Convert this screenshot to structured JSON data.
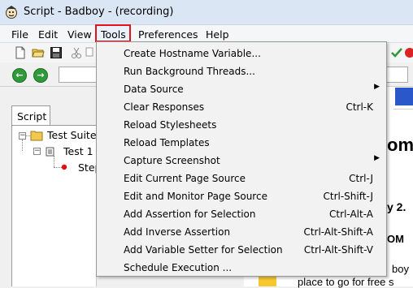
{
  "window": {
    "title": "Script - Badboy - (recording)"
  },
  "menubar": {
    "items": [
      {
        "label": "File"
      },
      {
        "label": "Edit"
      },
      {
        "label": "View"
      },
      {
        "label": "Tools"
      },
      {
        "label": "Preferences"
      },
      {
        "label": "Help"
      }
    ],
    "highlight_color": "#e0141a"
  },
  "tools_menu": {
    "items": [
      {
        "label": "Create Hostname Variable...",
        "shortcut": "",
        "submenu": false
      },
      {
        "label": "Run Background Threads...",
        "shortcut": "",
        "submenu": false
      },
      {
        "label": "Data Source",
        "shortcut": "",
        "submenu": true
      },
      {
        "label": "Clear Responses",
        "shortcut": "Ctrl-K",
        "submenu": false
      },
      {
        "label": "Reload Stylesheets",
        "shortcut": "",
        "submenu": false
      },
      {
        "label": "Reload Templates",
        "shortcut": "",
        "submenu": false
      },
      {
        "label": "Capture Screenshot",
        "shortcut": "",
        "submenu": true
      },
      {
        "label": "Edit Current Page Source",
        "shortcut": "Ctrl-J",
        "submenu": false
      },
      {
        "label": "Edit and Monitor Page Source",
        "shortcut": "Ctrl-Shift-J",
        "submenu": false
      },
      {
        "label": "Add Assertion for Selection",
        "shortcut": "Ctrl-Alt-A",
        "submenu": false
      },
      {
        "label": "Add Inverse Assertion",
        "shortcut": "Ctrl-Alt-Shift-A",
        "submenu": false
      },
      {
        "label": "Add Variable Setter for Selection",
        "shortcut": "Ctrl-Alt-Shift-V",
        "submenu": false
      },
      {
        "label": "Schedule Execution ...",
        "shortcut": "",
        "submenu": false
      }
    ]
  },
  "left_panel": {
    "tab_label": "Script",
    "tree": [
      {
        "label": "Test Suite"
      },
      {
        "label": "Test 1"
      },
      {
        "label": "Step"
      }
    ]
  },
  "right_panel": {
    "fragments": [
      "om",
      "y 2.",
      "OM",
      "boy",
      "place to go for free s"
    ]
  }
}
